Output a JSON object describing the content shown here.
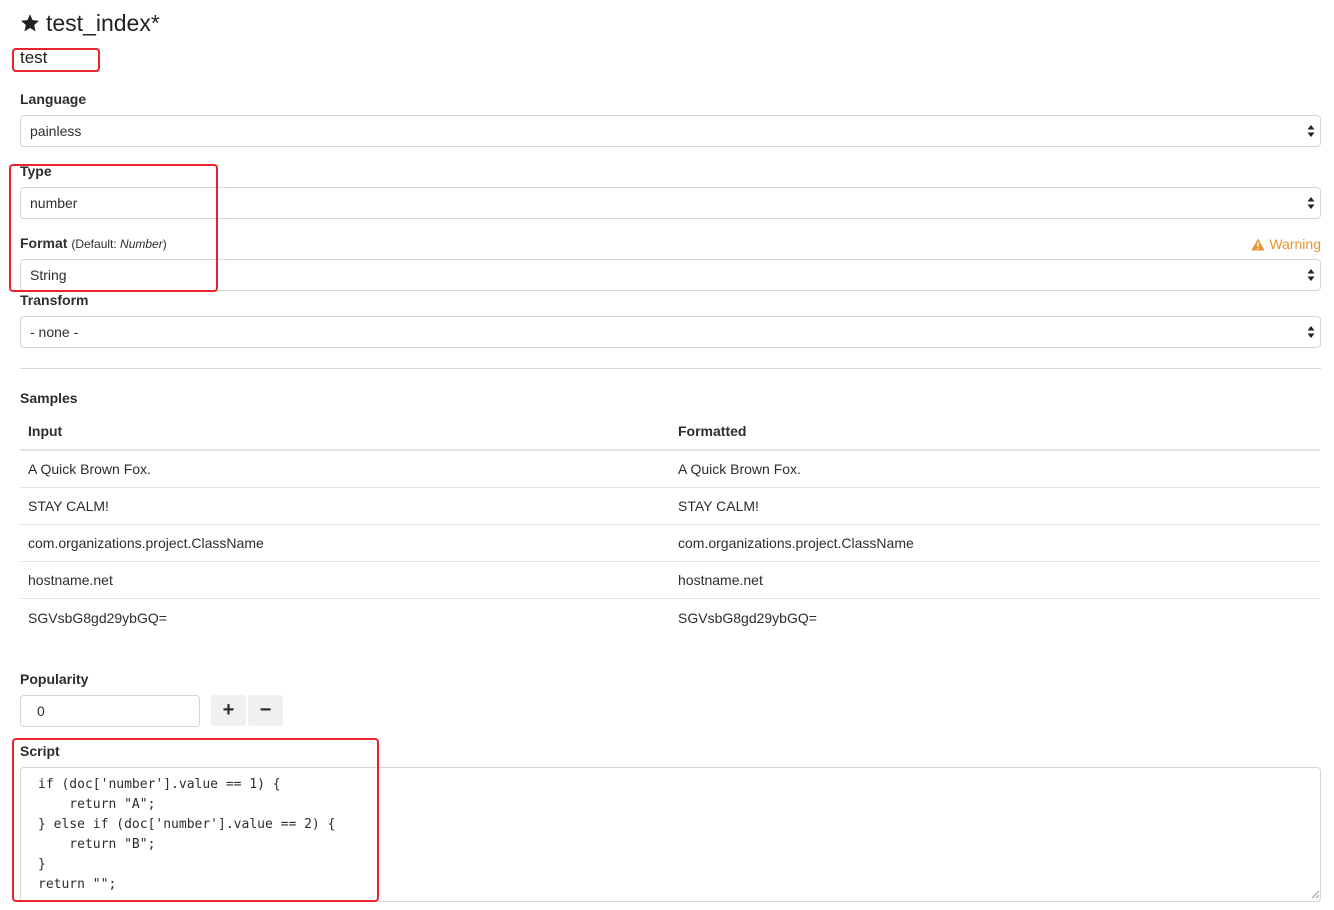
{
  "header": {
    "title": "test_index*",
    "field_name": "test"
  },
  "language": {
    "label": "Language",
    "value": "painless"
  },
  "type": {
    "label": "Type",
    "value": "number"
  },
  "format": {
    "label": "Format",
    "default_prefix": "(Default: ",
    "default_value": "Number",
    "default_suffix": ")",
    "value": "String",
    "warning": "Warning"
  },
  "transform": {
    "label": "Transform",
    "value": "- none -"
  },
  "samples": {
    "label": "Samples",
    "columns": [
      "Input",
      "Formatted"
    ],
    "rows": [
      [
        "A Quick Brown Fox.",
        "A Quick Brown Fox."
      ],
      [
        "STAY CALM!",
        "STAY CALM!"
      ],
      [
        "com.organizations.project.ClassName",
        "com.organizations.project.ClassName"
      ],
      [
        "hostname.net",
        "hostname.net"
      ],
      [
        "SGVsbG8gd29ybGQ=",
        "SGVsbG8gd29ybGQ="
      ]
    ]
  },
  "popularity": {
    "label": "Popularity",
    "value": "0",
    "increment_label": "+",
    "decrement_label": "−"
  },
  "script": {
    "label": "Script",
    "lines": [
      "if (doc['number'].value == 1) {",
      "    return \"A\";",
      "} else if (doc['number'].value == 2) {",
      "    return \"B\";",
      "}",
      "return \"\";"
    ]
  },
  "colors": {
    "highlight": "#e8232b",
    "warning": "#e8942e"
  },
  "icons": {
    "title": "star-icon",
    "warning": "warning-triangle-icon"
  }
}
